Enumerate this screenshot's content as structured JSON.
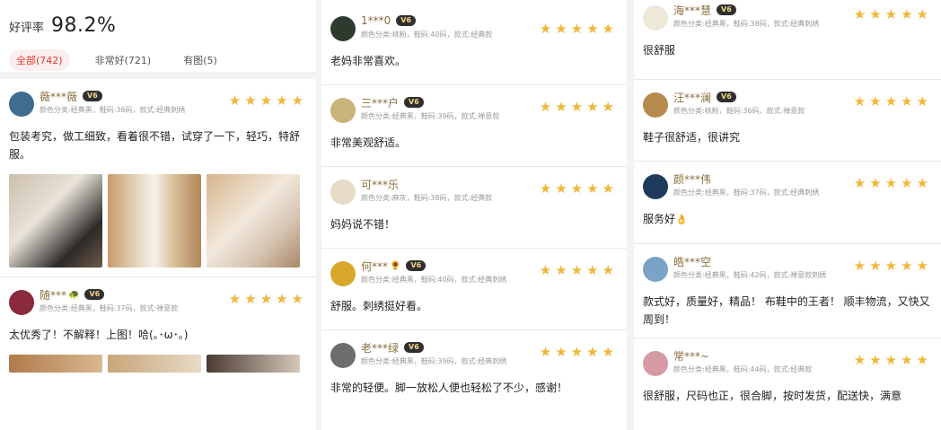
{
  "summary": {
    "rate_label": "好评率",
    "rate_value": "98.2%",
    "filters": [
      {
        "label": "全部(742)",
        "active": true
      },
      {
        "label": "非常好(721)",
        "active": false
      },
      {
        "label": "有图(5)",
        "active": false
      }
    ]
  },
  "colors": {
    "accent": "#e23a2a",
    "star": "#f2b63a",
    "badge_bg": "#2f2f2f",
    "badge_text": "#f2d58a"
  },
  "badge_label": "V6",
  "star_glyph": "★",
  "col1": [
    {
      "name": "薇***薇",
      "sku": "颜色分类:经典黑，鞋码:36码，款式:经典刺绣",
      "text": "包装考究，做工细致，看着很不错，试穿了一下，轻巧，特舒服。"
    },
    {
      "name": "随***",
      "name_emoji": "🐢",
      "sku": "颜色分类:经典黑，鞋码:37码，款式:禅意款",
      "text": "太优秀了！不解释！上图！哈(｡･ω･｡)"
    }
  ],
  "col3": [
    {
      "name": "1***0",
      "sku": "颜色分类:桃粉，鞋码:40码，款式:经典款",
      "text": "老妈非常喜欢。"
    },
    {
      "name": "三***户",
      "sku": "颜色分类:经典黑，鞋码:39码，款式:禅意款",
      "text": "非常美观舒适。"
    },
    {
      "name": "可***乐",
      "sku": "颜色分类:麻灰，鞋码:38码，款式:经典款",
      "text": "妈妈说不错！"
    },
    {
      "name": "何***",
      "name_emoji": "🌻",
      "sku": "颜色分类:经典黑，鞋码:40码，款式:经典刺绣",
      "text": "舒服。刺绣挺好看。"
    },
    {
      "name": "老***绿",
      "sku": "颜色分类:经典黑，鞋码:39码，款式:经典刺绣",
      "text": "非常的轻便。脚一放松人便也轻松了不少，感谢！"
    }
  ],
  "col5": [
    {
      "name": "海***慧",
      "sku": "颜色分类:经典黑，鞋码:38码，款式:经典刺绣",
      "text": "很舒服"
    },
    {
      "name": "汪***澜",
      "sku": "颜色分类:桃粉，鞋码:36码，款式:禅意款",
      "text": "鞋子很舒适，很讲究"
    },
    {
      "name": "颜***伟",
      "sku": "颜色分类:经典黑，鞋码:37码，款式:经典刺绣",
      "text": "服务好",
      "text_emoji": "👌"
    },
    {
      "name": "皓***空",
      "sku": "颜色分类:经典黑，鞋码:42码，款式:禅意款刺绣",
      "text": "款式好，质量好，精品！ 布鞋中的王者！ 顺丰物流，又快又周到！"
    },
    {
      "name": "常***~",
      "sku": "颜色分类:经典黑，鞋码:44码，款式:经典款",
      "text": "很舒服，尺码也正，很合脚，按时发货，配送快，满意"
    }
  ]
}
